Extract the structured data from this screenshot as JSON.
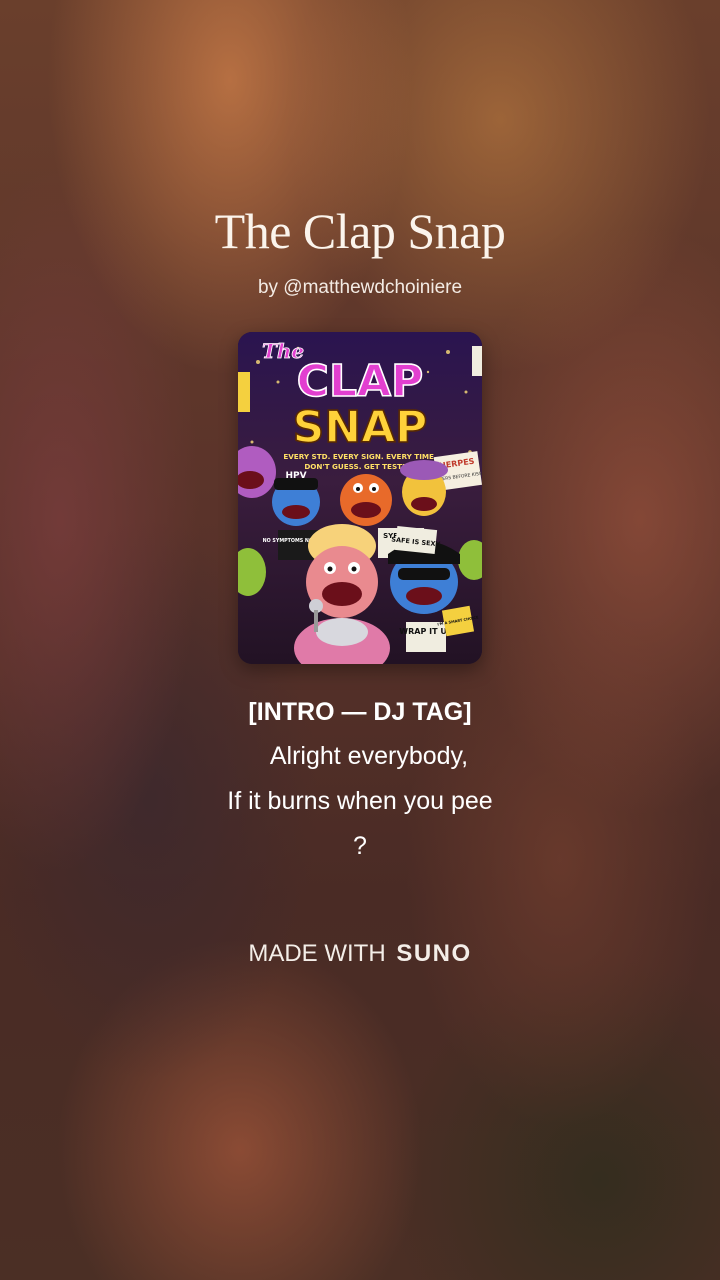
{
  "song": {
    "title": "The Clap Snap",
    "byline": "by @matthewdchoiniere"
  },
  "cover": {
    "title_the": "The",
    "title_clap": "CLAP",
    "title_snap": "SNAP",
    "tagline_1": "EVERY STD. EVERY SIGN. EVERY TIME.",
    "tagline_2": "DON'T GUESS. GET TESTED.",
    "sign_hpv": "HPV",
    "sign_herpes": "HERPES",
    "sign_herpes_sub": "BLISTERS BEFORE KISSES",
    "sign_syphilis": "SYPHILIS",
    "sign_no_symptoms": "NO SYMPTOMS NO MERCY",
    "sign_safe": "SAFE IS SEXY",
    "sign_wrap": "WRAP IT UP",
    "sign_smart": "I'M A SMART CHOICE",
    "colors": {
      "title_pink": "#e23fd0",
      "title_yellow": "#ffd23a",
      "puppet_pink": "#e98a8f",
      "puppet_blue": "#3e7fd6",
      "puppet_orange": "#e86a2a",
      "puppet_yellow": "#f2c23c"
    }
  },
  "lyrics": {
    "section": "[INTRO — DJ TAG]",
    "line1": "Alright everybody,",
    "line2": "If it burns when you pee",
    "line3": "?"
  },
  "footer": {
    "made_with": "MADE WITH",
    "brand": "SUNO"
  }
}
